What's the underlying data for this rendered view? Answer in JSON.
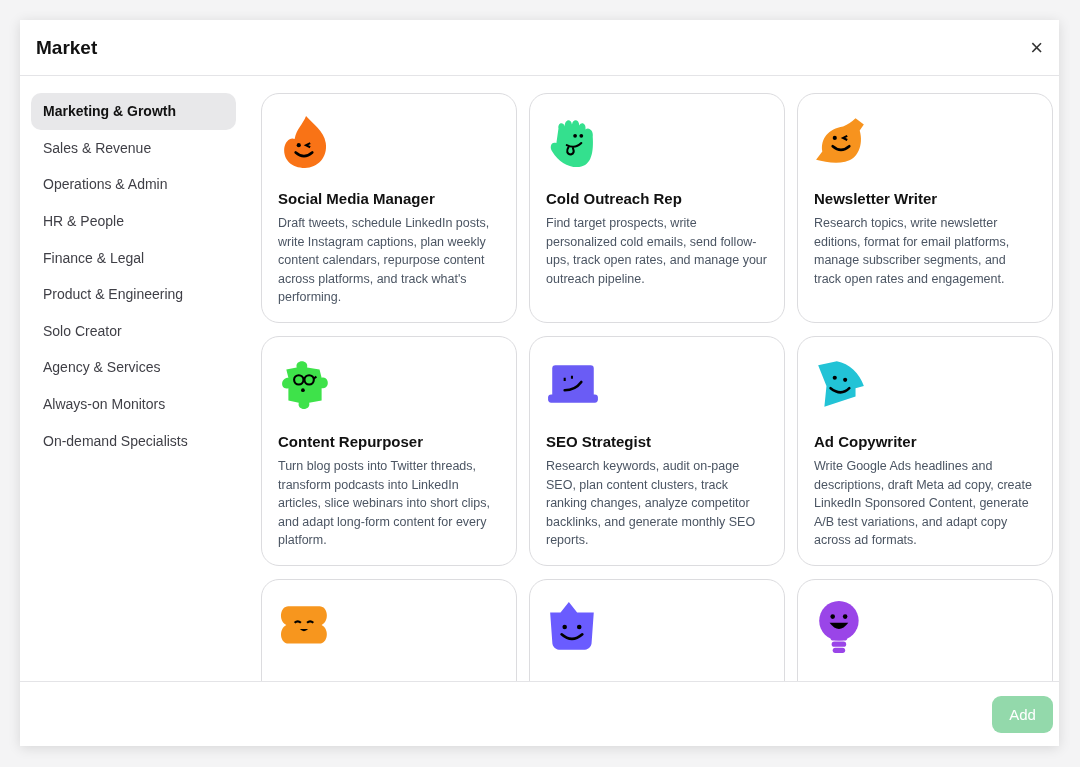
{
  "dialog": {
    "title": "Market",
    "close": "×"
  },
  "sidebar": {
    "items": [
      {
        "label": "Marketing & Growth",
        "selected": true
      },
      {
        "label": "Sales & Revenue",
        "selected": false
      },
      {
        "label": "Operations & Admin",
        "selected": false
      },
      {
        "label": "HR & People",
        "selected": false
      },
      {
        "label": "Finance & Legal",
        "selected": false
      },
      {
        "label": "Product & Engineering",
        "selected": false
      },
      {
        "label": "Solo Creator",
        "selected": false
      },
      {
        "label": "Agency & Services",
        "selected": false
      },
      {
        "label": "Always-on Monitors",
        "selected": false
      },
      {
        "label": "On-demand Specialists",
        "selected": false
      }
    ]
  },
  "cards": [
    {
      "kind": "flame",
      "color": "#f97316",
      "title": "Social Media Manager",
      "description": "Draft tweets, schedule LinkedIn posts, write Instagram captions, plan weekly content calendars, repurpose content across platforms, and track what's performing."
    },
    {
      "kind": "hand",
      "color": "#34e08e",
      "title": "Cold Outreach Rep",
      "description": "Find target prospects, write personalized cold emails, send follow-ups, track open rates, and manage your outreach pipeline."
    },
    {
      "kind": "leaf",
      "color": "#f7931e",
      "title": "Newsletter Writer",
      "description": "Research topics, write newsletter editions, format for email platforms, manage subscriber segments, and track open rates and engagement."
    },
    {
      "kind": "puzzle",
      "color": "#3ee24a",
      "title": "Content Repurposer",
      "description": "Turn blog posts into Twitter threads, transform podcasts into LinkedIn articles, slice webinars into short clips, and adapt long-form content for every platform."
    },
    {
      "kind": "laptop",
      "color": "#6a5cf5",
      "title": "SEO Strategist",
      "description": "Research keywords, audit on-page SEO, plan content clusters, track ranking changes, analyze competitor backlinks, and generate monthly SEO reports."
    },
    {
      "kind": "wedge",
      "color": "#22c3d6",
      "title": "Ad Copywriter",
      "description": "Write Google Ads headlines and descriptions, draft Meta ad copy, create LinkedIn Sponsored Content, generate A/B test variations, and adapt copy across ad formats."
    },
    {
      "kind": "blob",
      "color": "#f7961e"
    },
    {
      "kind": "crown",
      "color": "#6a5cff"
    },
    {
      "kind": "bulb",
      "color": "#9a45e8"
    }
  ],
  "footer": {
    "add_button": {
      "label": "Add",
      "disabled": true
    }
  }
}
